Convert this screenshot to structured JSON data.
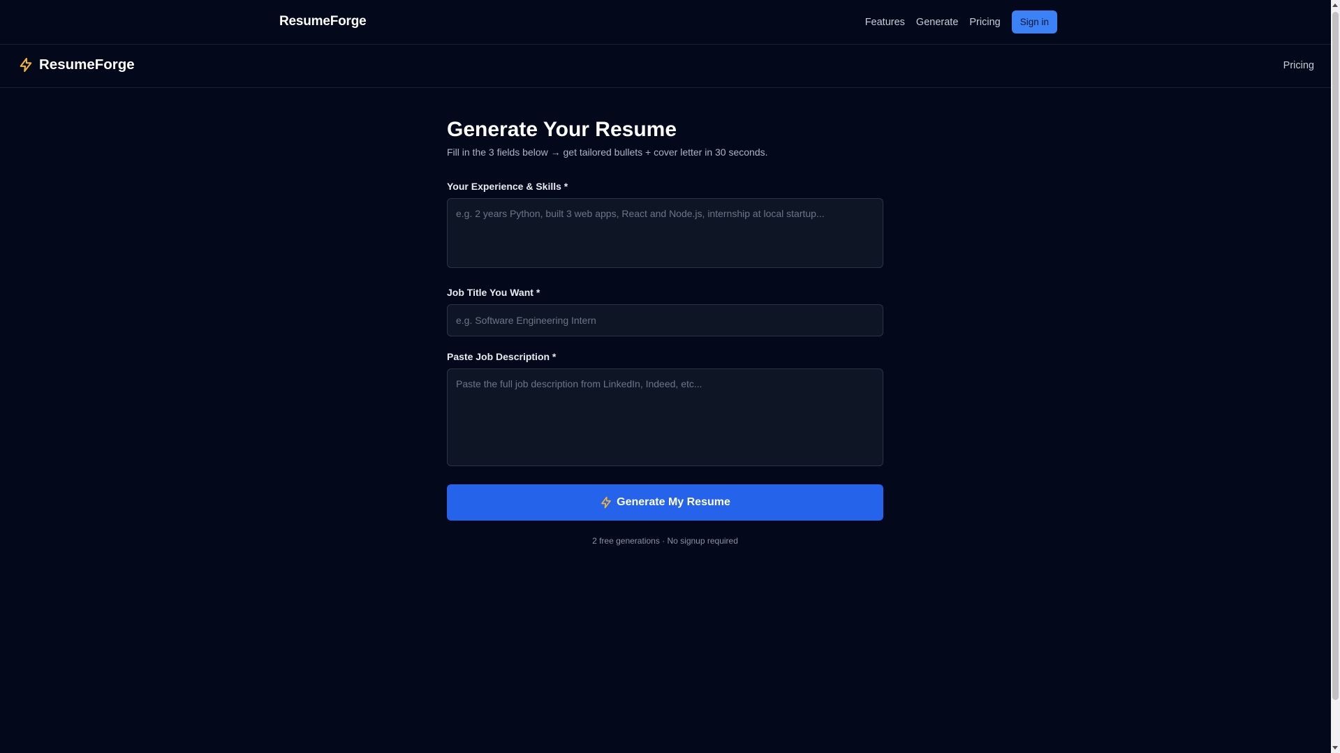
{
  "topnav": {
    "brand": "ResumeForge",
    "links": [
      "Features",
      "Generate",
      "Pricing"
    ],
    "signin_label": "Sign in"
  },
  "subnav": {
    "brand": "ResumeForge",
    "pricing_label": "Pricing",
    "icon": "bolt-icon"
  },
  "form": {
    "title": "Generate Your Resume",
    "subtitle": "Fill in the 3 fields below → get tailored bullets + cover letter in 30 seconds.",
    "experience": {
      "label": "Your Experience & Skills *",
      "placeholder": "e.g. 2 years Python, built 3 web apps, React and Node.js, internship at local startup...",
      "value": ""
    },
    "job_title": {
      "label": "Job Title You Want *",
      "placeholder": "e.g. Software Engineering Intern",
      "value": ""
    },
    "job_description": {
      "label": "Paste Job Description *",
      "placeholder": "Paste the full job description from LinkedIn, Indeed, etc...",
      "value": ""
    },
    "submit_label": "Generate My Resume",
    "note": "2 free generations · No signup required"
  },
  "colors": {
    "background": "#03081a",
    "accent": "#2563eb",
    "signin": "#3b82f6",
    "bolt": "#f5b731"
  }
}
